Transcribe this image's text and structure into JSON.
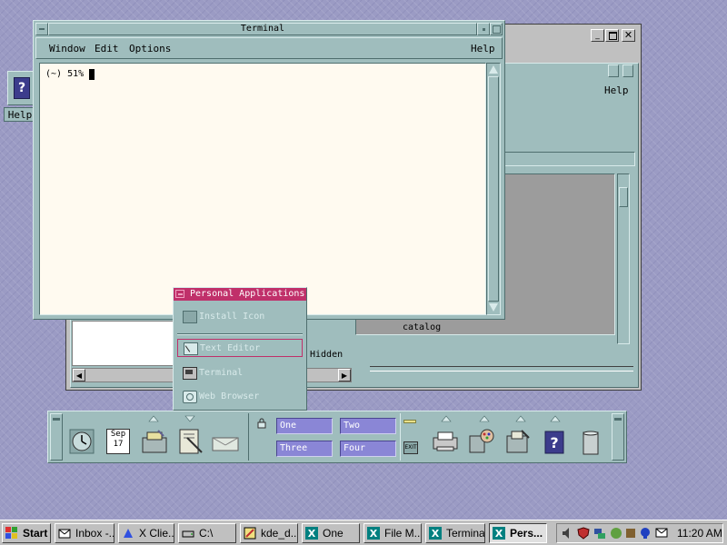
{
  "desktop": {
    "help_icon_label": "Help"
  },
  "back_window": {
    "menu_help": "Help",
    "folder_label": "catalog",
    "status_text": "Hidden"
  },
  "terminal": {
    "title": "Terminal",
    "menu": {
      "window": "Window",
      "edit": "Edit",
      "options": "Options",
      "help": "Help"
    },
    "prompt": "(~) 51%"
  },
  "popup_menu": {
    "title": "Personal Applications",
    "items": [
      {
        "label": "Install Icon",
        "icon": "install-icon"
      },
      {
        "label": "Text Editor",
        "icon": "text-editor-icon",
        "highlighted": true
      },
      {
        "label": "Terminal",
        "icon": "terminal-icon"
      },
      {
        "label": "Web Browser",
        "icon": "web-browser-icon"
      }
    ]
  },
  "front_panel": {
    "calendar": {
      "month": "Sep",
      "day": "17"
    },
    "workspaces": [
      "One",
      "Two",
      "Three",
      "Four"
    ],
    "exit_label": "EXIT"
  },
  "taskbar": {
    "start_label": "Start",
    "buttons": [
      {
        "label": "Inbox -...",
        "icon": "mail-icon",
        "active": false
      },
      {
        "label": "X Clie...",
        "icon": "x-client-icon",
        "active": false
      },
      {
        "label": "C:\\",
        "icon": "drive-icon",
        "active": false
      },
      {
        "label": "kde_d...",
        "icon": "paint-icon",
        "active": false
      },
      {
        "label": "One",
        "icon": "x-icon",
        "active": false
      },
      {
        "label": "File M...",
        "icon": "x-icon",
        "active": false
      },
      {
        "label": "Terminal",
        "icon": "x-icon",
        "active": false
      },
      {
        "label": "Pers...",
        "icon": "x-icon",
        "active": true
      }
    ],
    "clock": "11:20 AM"
  },
  "colors": {
    "desktop": "#9b9bc4",
    "cde_panel": "#9fbdbd",
    "terminal_bg": "#fffaf0",
    "menu_title": "#c0306a",
    "workspace_btn": "#8a86d6"
  }
}
